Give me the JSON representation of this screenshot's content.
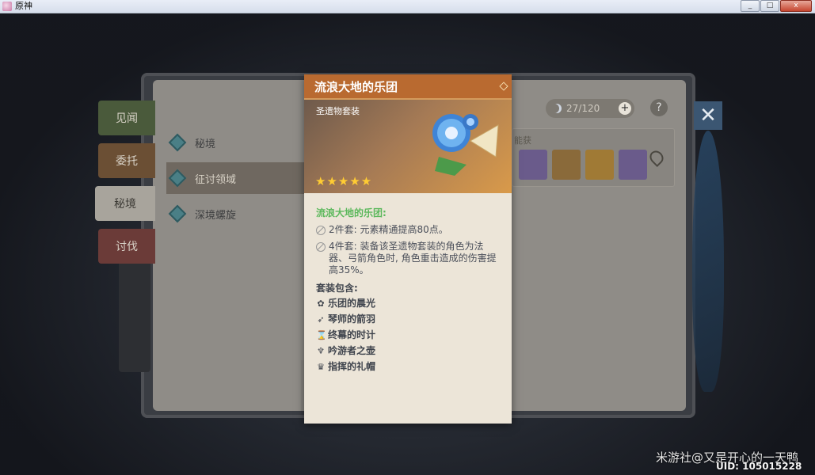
{
  "window": {
    "title": "原神",
    "minimize": "_",
    "maximize": "□",
    "close": "x"
  },
  "side_tabs": [
    "见闻",
    "委托",
    "秘境",
    "讨伐"
  ],
  "menu": [
    "秘境",
    "征讨领域",
    "深境螺旋"
  ],
  "resin": {
    "value": "27/120",
    "plus": "+"
  },
  "help": "?",
  "close_button": "✕",
  "rewards_label": "能获",
  "artifact_card": {
    "title": "流浪大地的乐团",
    "subtitle": "圣遗物套装",
    "stars": "★★★★★",
    "rarity": 5,
    "set_name": "流浪大地的乐团:",
    "effect_2": "2件套: 元素精通提高80点。",
    "effect_4": "4件套: 装备该圣遗物套装的角色为法器、弓箭角色时, 角色重击造成的伤害提高35%。",
    "contains_label": "套装包含:",
    "pieces": [
      {
        "name": "乐团的晨光",
        "icon": "flower-icon"
      },
      {
        "name": "琴师的箭羽",
        "icon": "feather-icon"
      },
      {
        "name": "终幕的时计",
        "icon": "hourglass-icon"
      },
      {
        "name": "吟游者之壶",
        "icon": "goblet-icon"
      },
      {
        "name": "指挥的礼帽",
        "icon": "crown-icon"
      }
    ],
    "colors": {
      "header": "#b96a30",
      "set_name": "#5cb85c",
      "stars": "#ffcc33"
    }
  },
  "watermark": "米游社@又是开心的一天鸭",
  "uid": "UID: 105015228"
}
